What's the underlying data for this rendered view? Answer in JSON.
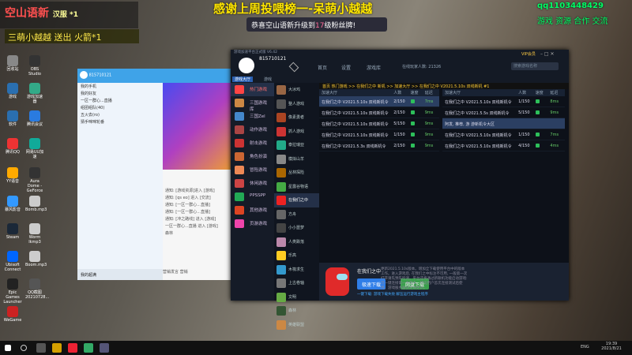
{
  "overlay": {
    "channel_title": "空山语新",
    "channel_badge": "汉服 *1",
    "hot_line": "三萌小越越 送出 火箭*1",
    "thanks_banner": "感谢上周投喂榜一-呆萌小越越",
    "upgrade_prefix": "恭喜空山语新升级到",
    "upgrade_level": "17",
    "upgrade_suffix": "级粉丝牌!",
    "qq_line": "qq1103448429",
    "qq_tag": "游戏 资源 合作 交流"
  },
  "desktop_icons": [
    {
      "label": "回收站",
      "color": "#888"
    },
    {
      "label": "OBS Studio",
      "color": "#333"
    },
    {
      "label": "游戏",
      "color": "#2a6fb0"
    },
    {
      "label": "游戏加速器",
      "color": "#3a8"
    },
    {
      "label": "软件",
      "color": "#2a6fb0"
    },
    {
      "label": "腾讯会议",
      "color": "#2a7be0"
    },
    {
      "label": "腾讯QQ",
      "color": "#e33"
    },
    {
      "label": "网易UU加速",
      "color": "#1a9"
    },
    {
      "label": "YY语音",
      "color": "#fa0"
    },
    {
      "label": "Aura Dome - GeForce",
      "color": "#333"
    },
    {
      "label": "暴风影音",
      "color": "#39f"
    },
    {
      "label": "Bomb.mp3",
      "color": "#ccc"
    },
    {
      "label": "Steam",
      "color": "#1b2838"
    },
    {
      "label": "Worm Ikmp3",
      "color": "#ccc"
    },
    {
      "label": "Ubisoft Connect",
      "color": "#06f"
    },
    {
      "label": "Boom.mp3",
      "color": "#ccc"
    },
    {
      "label": "Epic Games Launcher",
      "color": "#222"
    },
    {
      "label": "QQ截图20210728...",
      "color": "#555"
    },
    {
      "label": "WeGame",
      "color": "#c22"
    }
  ],
  "qq": {
    "nickname": "815710121",
    "status": "我的手机",
    "groups": [
      "我的好友",
      "一区一群心...直播",
      "组团组队(40)",
      "五火去(ro)",
      "猜手咪咪轮番"
    ],
    "footer_label": "我的超满"
  },
  "chat": {
    "lines": [
      "通知: [游戏资源]进入 [游戏]",
      "通知: [qs eo] 进入 [交流]",
      "通知: [一区一群心...直播]",
      "通知: [一区一群心...直播]",
      "通知: [冲之路线] 进入 [游戏]",
      "一区一群心...直播 进入 [游戏]",
      "森林"
    ],
    "footer": [
      "营销发言",
      "营销"
    ]
  },
  "launcher": {
    "title": "游戏加速平台正式版 V6.42",
    "user_id": "815710121",
    "nav": [
      "首页",
      "设置",
      "游戏库"
    ],
    "online_label": "在线玩家人数: 21326",
    "search_placeholder": "搜索游戏名称",
    "vip_label": "VIP会员",
    "tabs": [
      "游戏大厅",
      "游戏"
    ],
    "side_items": [
      {
        "label": "热门游戏",
        "color": "#f44"
      },
      {
        "label": "三国游戏库",
        "color": "#c84"
      },
      {
        "label": "三国Zel",
        "color": "#48c"
      },
      {
        "label": "动作游戏",
        "color": "#a44"
      },
      {
        "label": "射击游戏",
        "color": "#c33"
      },
      {
        "label": "角色扮演",
        "color": "#c63"
      },
      {
        "label": "冒险游戏",
        "color": "#e85"
      },
      {
        "label": "休闲游戏",
        "color": "#c44"
      },
      {
        "label": "PPSSPP",
        "color": "#2a5"
      },
      {
        "label": "其他游戏",
        "color": "#d42"
      },
      {
        "label": "页游游戏",
        "color": "#e4a"
      }
    ],
    "game_items": [
      {
        "label": "大冰鸡",
        "color": "#964"
      },
      {
        "label": "整人游戏",
        "color": "#555"
      },
      {
        "label": "像素勇者",
        "color": "#a42"
      },
      {
        "label": "抓人游戏",
        "color": "#c33"
      },
      {
        "label": "泰拉瑞亚",
        "color": "#2a8"
      },
      {
        "label": "模拟山羊",
        "color": "#888"
      },
      {
        "label": "丛林探险",
        "color": "#a60"
      },
      {
        "label": "星露谷物语",
        "color": "#4a4"
      },
      {
        "label": "在我们之中",
        "color": "#e22"
      },
      {
        "label": "方舟",
        "color": "#666"
      },
      {
        "label": "小小噩梦",
        "color": "#444"
      },
      {
        "label": "人类跌落",
        "color": "#b8a"
      },
      {
        "label": "乐高",
        "color": "#fc2"
      },
      {
        "label": "木筏求生",
        "color": "#39c"
      },
      {
        "label": "上古卷轴",
        "color": "#777"
      },
      {
        "label": "文明",
        "color": "#6a4"
      },
      {
        "label": "森林",
        "color": "#353"
      },
      {
        "label": "英雄联盟",
        "color": "#c84"
      }
    ],
    "breadcrumb": "首页 热门游戏 >> 在我们之中 新机 >> 加速大厅 >> 在我们之中 V2021.5.10s 双线新机 #1",
    "left_head": [
      "加速大厅",
      "人数",
      "速度",
      "延迟"
    ],
    "right_head": [
      "加速大厅",
      "人数",
      "速度",
      "延迟"
    ],
    "left_rows": [
      {
        "name": "在我们之中 V2021.5.10s 双线新机令",
        "count": "2/150",
        "ping": "7ms",
        "sel": true
      },
      {
        "name": "在我们之中 V2021.5.10s 双线新机令",
        "count": "2/150",
        "ping": "9ms",
        "sel": false
      },
      {
        "name": "在我们之中 V2021.5.10s 双线新机令",
        "count": "5/150",
        "ping": "9ms",
        "sel": false
      },
      {
        "name": "在我们之中 V2021.5.10s 双线新机令",
        "count": "1/150",
        "ping": "9ms",
        "sel": false
      },
      {
        "name": "在我们之中 V2021.5.3s 双线新机令",
        "count": "2/150",
        "ping": "9ms",
        "sel": false
      }
    ],
    "right_rows": [
      {
        "name": "在我们之中 V2021.5.10s 双线新机令",
        "count": "1/150",
        "ping": "8ms",
        "sel": false
      },
      {
        "name": "在我们之中 V2021.5.5s 双线新机令",
        "count": "5/150",
        "ping": "9ms",
        "sel": false
      },
      {
        "name": "阿发, 推荐, 游 游新机令大区",
        "count": "",
        "ping": "",
        "sel": true
      },
      {
        "name": "在我们之中 V2021.5.10s 双线新机令",
        "count": "1/150",
        "ping": "7ms",
        "sel": false
      },
      {
        "name": "在我们之中 V2021.5.10s 双线新机令",
        "count": "4/150",
        "ping": "4ms",
        "sel": false
      }
    ],
    "card_title": "在我们之中",
    "btn_fast": "极速下载",
    "btn_net": "网盘下载",
    "card_links": "一键下载: 游戏下载失败  解压运行游戏主程序",
    "description": "更新2021.5.10s版本。增加全下载使用平台中的版本工作。进入游戏后, 在我们之中标注不可用, 一般第一次打开请先预先检测。平台还将通过新联机功能启动游戏: 可一键连接第一手版本。建议用户首次连接测试后使用。游戏服务器会定期更新。"
  },
  "taskbar": {
    "lang": "ENG",
    "time": "19:39",
    "date": "2021/8/21"
  }
}
